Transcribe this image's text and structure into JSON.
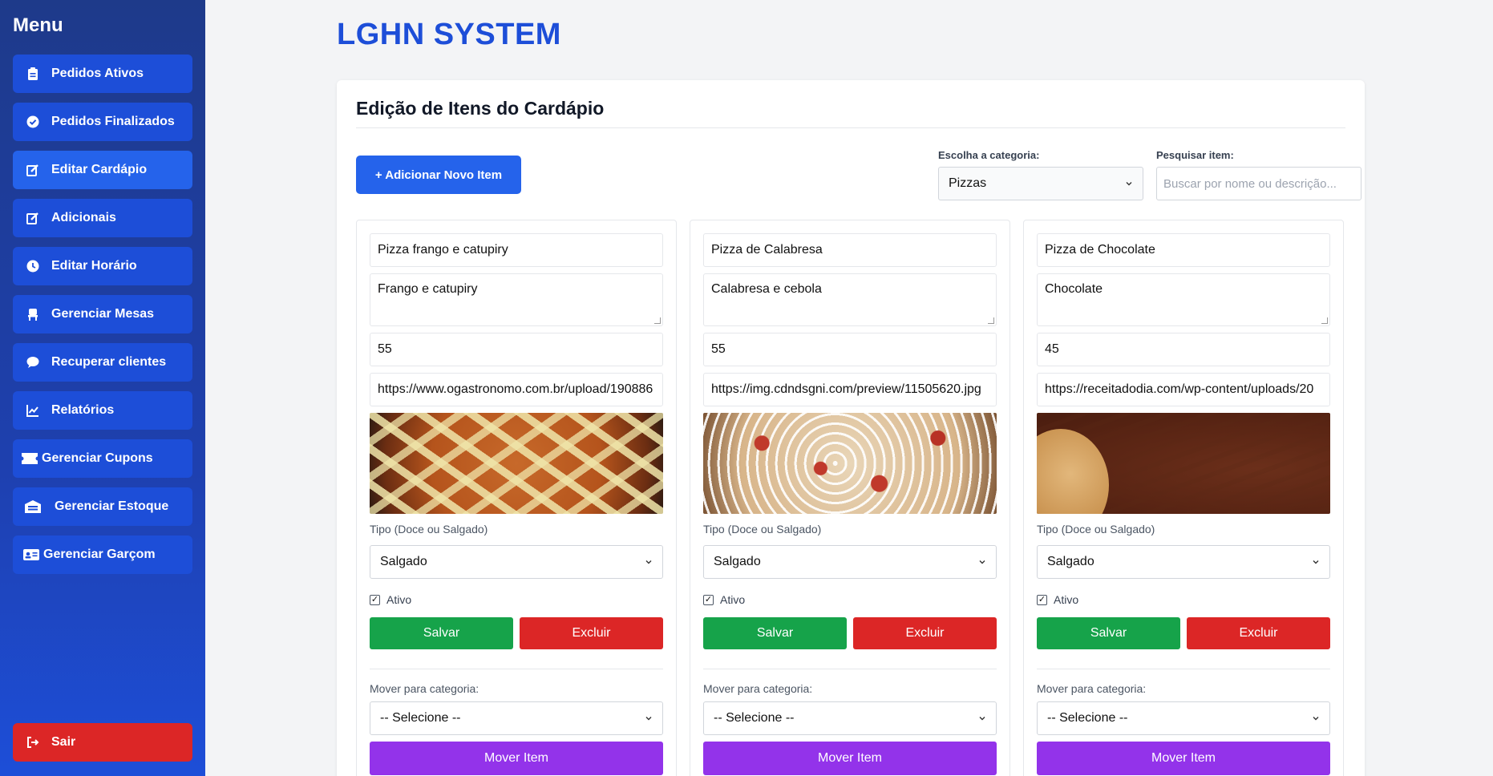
{
  "sidebar": {
    "title": "Menu",
    "items": [
      {
        "label": "Pedidos Ativos",
        "icon": "clipboard-icon"
      },
      {
        "label": "Pedidos Finalizados",
        "icon": "check-circle-icon"
      },
      {
        "label": "Editar Cardápio",
        "icon": "edit-icon"
      },
      {
        "label": "Adicionais",
        "icon": "edit-icon"
      },
      {
        "label": "Editar Horário",
        "icon": "clock-icon"
      },
      {
        "label": "Gerenciar Mesas",
        "icon": "chair-icon"
      },
      {
        "label": "Recuperar clientes",
        "icon": "chat-icon"
      },
      {
        "label": "Relatórios",
        "icon": "chart-line-icon"
      },
      {
        "label": "Gerenciar Cupons",
        "icon": "ticket-icon"
      },
      {
        "label": "Gerenciar Estoque",
        "icon": "warehouse-icon"
      },
      {
        "label": "Gerenciar Garçom",
        "icon": "id-card-icon"
      }
    ],
    "active_index": 2,
    "logout_label": "Sair"
  },
  "header": {
    "brand": "LGHN SYSTEM"
  },
  "panel": {
    "title": "Edição de Itens do Cardápio",
    "add_button": "+ Adicionar Novo Item",
    "category_label": "Escolha a categoria:",
    "category_value": "Pizzas",
    "search_label": "Pesquisar item:",
    "search_placeholder": "Buscar por nome ou descrição..."
  },
  "items": [
    {
      "name": "Pizza frango e catupiry",
      "description": "Frango e catupiry",
      "price": "55",
      "image_url": "https://www.ogastronomo.com.br/upload/190886",
      "type_label": "Tipo (Doce ou Salgado)",
      "type_value": "Salgado",
      "active_label": "Ativo",
      "save": "Salvar",
      "delete": "Excluir",
      "move_label": "Mover para categoria:",
      "move_select": "-- Selecione --",
      "move_button": "Mover Item"
    },
    {
      "name": "Pizza de Calabresa",
      "description": "Calabresa e cebola",
      "price": "55",
      "image_url": "https://img.cdndsgni.com/preview/11505620.jpg",
      "type_label": "Tipo (Doce ou Salgado)",
      "type_value": "Salgado",
      "active_label": "Ativo",
      "save": "Salvar",
      "delete": "Excluir",
      "move_label": "Mover para categoria:",
      "move_select": "-- Selecione --",
      "move_button": "Mover Item"
    },
    {
      "name": "Pizza de Chocolate",
      "description": "Chocolate",
      "price": "45",
      "image_url": "https://receitadodia.com/wp-content/uploads/20",
      "type_label": "Tipo (Doce ou Salgado)",
      "type_value": "Salgado",
      "active_label": "Ativo",
      "save": "Salvar",
      "delete": "Excluir",
      "move_label": "Mover para categoria:",
      "move_select": "-- Selecione --",
      "move_button": "Mover Item"
    }
  ],
  "colors": {
    "primary": "#2563eb",
    "sidebar": "#1e40af",
    "save": "#16a34a",
    "delete": "#dc2626",
    "move": "#9333ea",
    "brand": "#1d4ed8"
  }
}
